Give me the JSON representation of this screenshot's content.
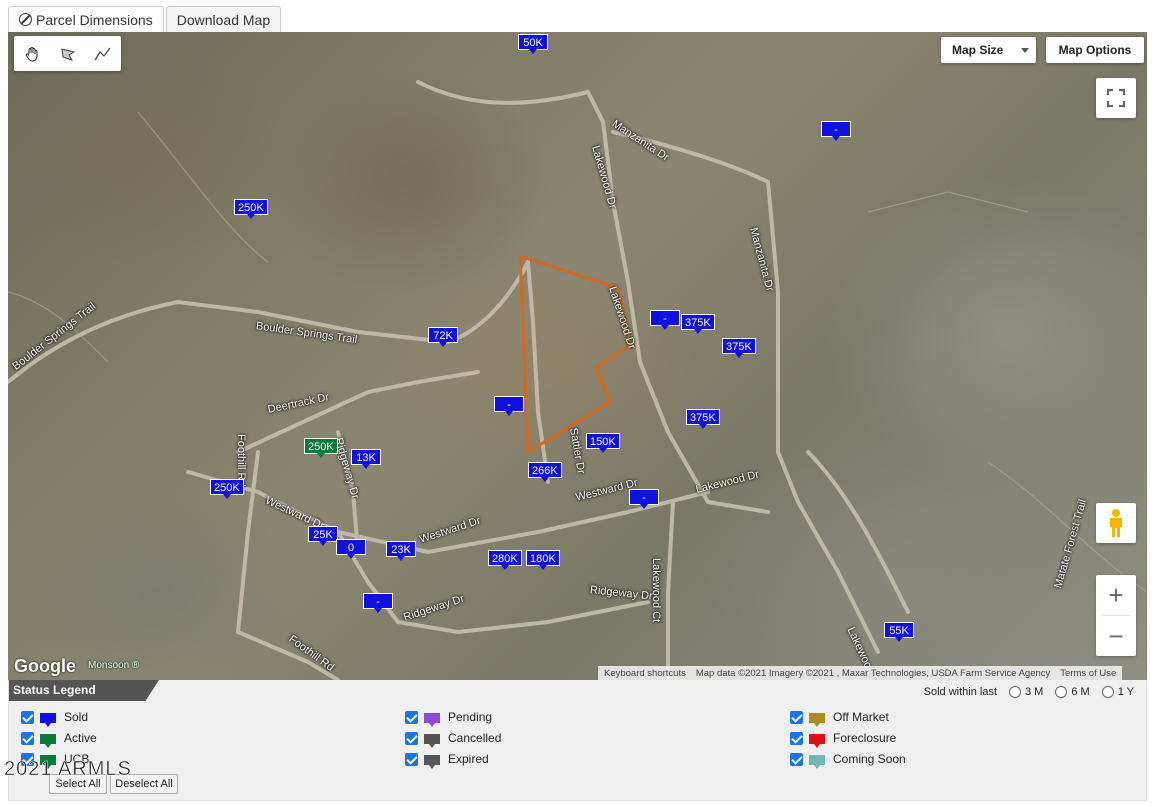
{
  "tabs": [
    {
      "label": "Parcel Dimensions",
      "icon": "ban-icon"
    },
    {
      "label": "Download Map"
    }
  ],
  "map": {
    "map_size_label": "Map Size",
    "map_options_label": "Map Options",
    "zoom_in": "+",
    "zoom_out": "−",
    "google_label": "Google",
    "monsoon_label": "Monsoon ®",
    "attribution": {
      "shortcuts": "Keyboard shortcuts",
      "data": "Map data ©2021 Imagery ©2021 , Maxar Technologies, USDA Farm Service Agency",
      "terms": "Terms of Use"
    },
    "streets": {
      "boulder_springs_left": "Boulder Springs Trail",
      "boulder_springs_right": "Boulder Springs Trail",
      "manzanita_top": "Manzanita Dr",
      "manzanita_right": "Manzanita Dr",
      "lakewood_top": "Lakewood Dr",
      "lakewood_mid": "Lakewood Dr",
      "lakewood_east": "Lakewood Dr",
      "lakewood_bottom": "Lakewood Dr",
      "lakewood_ct": "Lakewood Ct",
      "deertrack": "Deertrack Dr",
      "foothill_top": "Foothill Rd",
      "foothill_bottom": "Foothill Rd",
      "ridgeway_top": "Ridgeway Dr",
      "ridgeway_mid": "Ridgeway Dr",
      "ridgeway_right": "Ridgeway Dr",
      "westward_left": "Westward Dr",
      "westward_mid": "Westward Dr",
      "westward_right": "Westward Dr",
      "sattler": "Sattler Dr",
      "matate": "Matate Forest Trail"
    },
    "markers": [
      {
        "label": "50K",
        "color": "#1010e0"
      },
      {
        "label": "-",
        "color": "#1010e0"
      },
      {
        "label": "250K",
        "color": "#1010e0"
      },
      {
        "label": "72K",
        "color": "#1010e0"
      },
      {
        "label": "-",
        "color": "#1010e0"
      },
      {
        "label": "375K",
        "color": "#1010e0"
      },
      {
        "label": "375K",
        "color": "#1010e0"
      },
      {
        "label": "-",
        "color": "#1010e0"
      },
      {
        "label": "375K",
        "color": "#1010e0"
      },
      {
        "label": "150K",
        "color": "#1010e0"
      },
      {
        "label": "250K",
        "color": "#0a7a3a"
      },
      {
        "label": "13K",
        "color": "#1010e0"
      },
      {
        "label": "266K",
        "color": "#1010e0"
      },
      {
        "label": "250K",
        "color": "#1010e0"
      },
      {
        "label": "-",
        "color": "#1010e0"
      },
      {
        "label": "25K",
        "color": "#1010e0"
      },
      {
        "label": "0",
        "color": "#1010e0"
      },
      {
        "label": "23K",
        "color": "#1010e0"
      },
      {
        "label": "280K",
        "color": "#1010e0"
      },
      {
        "label": "180K",
        "color": "#1010e0"
      },
      {
        "label": "-",
        "color": "#1010e0"
      },
      {
        "label": "55K",
        "color": "#1010e0"
      }
    ]
  },
  "legend": {
    "title": "Status Legend",
    "sold_within_label": "Sold within last",
    "periods": [
      "3 M",
      "6 M",
      "1 Y"
    ],
    "items": [
      {
        "label": "Sold",
        "color": "#1010e0"
      },
      {
        "label": "Active",
        "color": "#0a7a3a"
      },
      {
        "label": "UCB",
        "color": "#0a7a3a"
      },
      {
        "label": "Pending",
        "color": "#8a4bd6"
      },
      {
        "label": "Cancelled",
        "color": "#555555"
      },
      {
        "label": "Expired",
        "color": "#555555"
      },
      {
        "label": "Off Market",
        "color": "#b08a1e"
      },
      {
        "label": "Foreclosure",
        "color": "#e01010"
      },
      {
        "label": "Coming Soon",
        "color": "#6fb9b3"
      }
    ],
    "select_all": "Select All",
    "deselect_all": "Deselect All"
  },
  "watermark": "2021 ARMLS"
}
